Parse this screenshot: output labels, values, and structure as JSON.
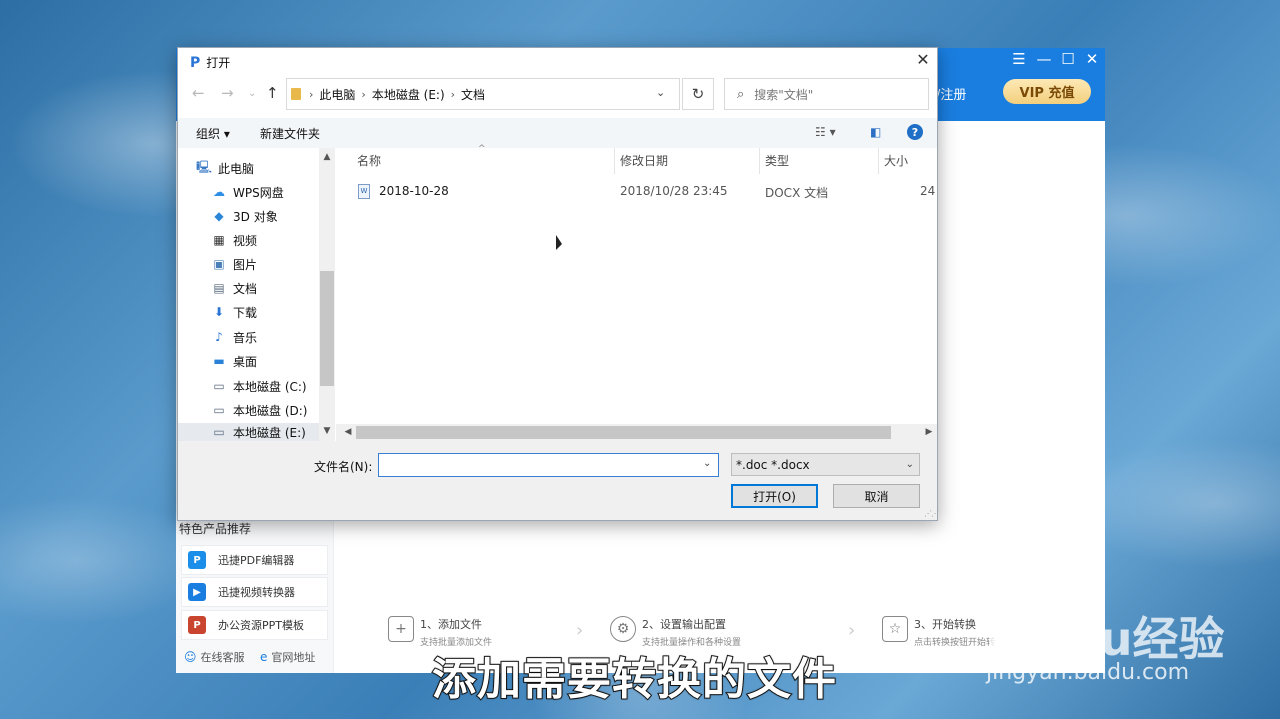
{
  "app": {
    "login_text": "/注册",
    "vip_button": "VIP 充值",
    "featured_title": "特色产品推荐",
    "featured": [
      {
        "label": "迅捷PDF编辑器",
        "icon": "pdf-editor-icon",
        "color": "#1a8ee8"
      },
      {
        "label": "迅捷视频转换器",
        "icon": "video-converter-icon",
        "color": "#1a7ee0"
      },
      {
        "label": "办公资源PPT模板",
        "icon": "ppt-template-icon",
        "color": "#c9452f"
      }
    ],
    "footer": {
      "support": "在线客服",
      "website": "官网地址"
    },
    "steps": [
      {
        "title": "1、添加文件",
        "desc": "支持批量添加文件"
      },
      {
        "title": "2、设置输出配置",
        "desc": "支持批量操作和各种设置"
      },
      {
        "title": "3、开始转换",
        "desc": "点击转换按钮开始转"
      }
    ]
  },
  "dialog": {
    "title": "打开",
    "breadcrumb": [
      "此电脑",
      "本地磁盘 (E:)",
      "文档"
    ],
    "search_placeholder": "搜索\"文档\"",
    "toolbar": {
      "organize": "组织 ▾",
      "new_folder": "新建文件夹",
      "help": "?"
    },
    "nav_items": [
      {
        "label": "此电脑",
        "icon": "computer-icon"
      },
      {
        "label": "WPS网盘",
        "icon": "cloud-icon"
      },
      {
        "label": "3D 对象",
        "icon": "cube-icon"
      },
      {
        "label": "视频",
        "icon": "video-icon"
      },
      {
        "label": "图片",
        "icon": "picture-icon"
      },
      {
        "label": "文档",
        "icon": "document-icon"
      },
      {
        "label": "下载",
        "icon": "download-icon"
      },
      {
        "label": "音乐",
        "icon": "music-icon"
      },
      {
        "label": "桌面",
        "icon": "desktop-icon"
      },
      {
        "label": "本地磁盘 (C:)",
        "icon": "drive-icon"
      },
      {
        "label": "本地磁盘 (D:)",
        "icon": "drive-icon"
      },
      {
        "label": "本地磁盘 (E:)",
        "icon": "drive-icon",
        "selected": true
      }
    ],
    "columns": {
      "name": "名称",
      "modified": "修改日期",
      "type": "类型",
      "size": "大小"
    },
    "files": [
      {
        "name": "2018-10-28",
        "modified": "2018/10/28 23:45",
        "type": "DOCX 文档",
        "size": "24"
      }
    ],
    "filename_label": "文件名(N):",
    "filename_value": "",
    "file_type": "*.doc *.docx",
    "open_button": "打开(O)",
    "cancel_button": "取消"
  },
  "overlay": {
    "subtitle": "添加需要转换的文件",
    "watermark_logo": "Baidu经验",
    "watermark_url": "jingyan.baidu.com"
  },
  "colors": {
    "accent": "#1a7ee0",
    "dialog_border": "#0078d7",
    "vip": "#f3cf7d"
  }
}
